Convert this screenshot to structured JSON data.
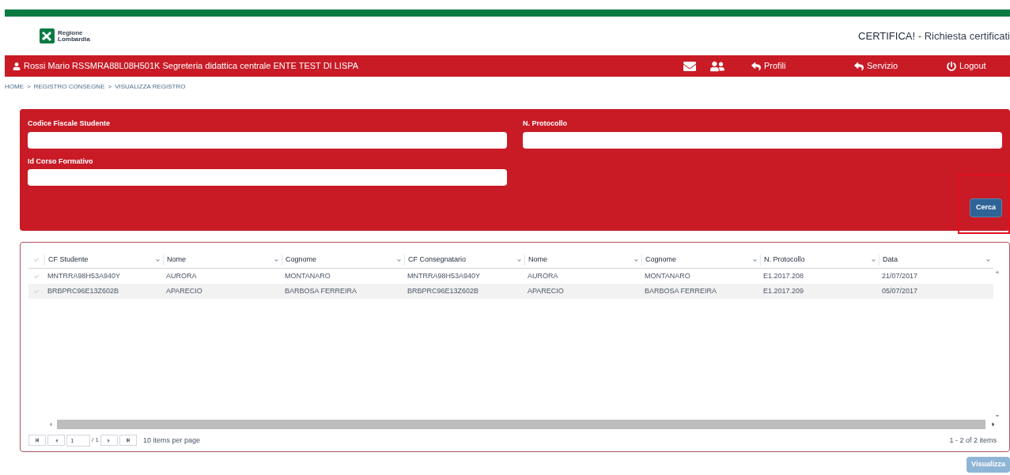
{
  "header": {
    "logo_text": [
      "Regione",
      "Lombardia"
    ],
    "app_title": "CERTIFICA!",
    "app_subtitle": " - Richiesta certificati"
  },
  "user_bar": {
    "user": "Rossi Mario RSSMRA88L08H501K Segreteria didattica centrale ENTE TEST DI LISPA",
    "links": [
      {
        "kind": "back",
        "label": "Profili"
      },
      {
        "kind": "back",
        "label": "Servizio"
      },
      {
        "kind": "power",
        "label": "Logout"
      }
    ]
  },
  "breadcrumb": {
    "items": [
      "HOME",
      "REGISTRO CONSEGNE",
      "VISUALIZZA REGISTRO"
    ],
    "separator": ">"
  },
  "search_form": {
    "fields": [
      {
        "label": "Codice Fiscale Studente"
      },
      {
        "label": "N. Protocollo"
      },
      {
        "label": "Id Corso Formativo"
      }
    ],
    "button": "Cerca"
  },
  "table": {
    "columns": [
      "CF Studente",
      "Nome",
      "Cognome",
      "CF Consegnatario",
      "Nome",
      "Cognome",
      "N. Protocollo",
      "Data"
    ],
    "rows": [
      [
        "MNTRRA98H53A940Y",
        "AURORA",
        "MONTANARO",
        "MNTRRA98H53A940Y",
        "AURORA",
        "MONTANARO",
        "E1.2017.208",
        "21/07/2017"
      ],
      [
        "BRBPRC96E13Z602B",
        "APARECIO",
        "BARBOSA FERREIRA",
        "BRBPRC96E13Z602B",
        "APARECIO",
        "BARBOSA FERREIRA",
        "E1.2017.209",
        "05/07/2017"
      ]
    ],
    "pager": {
      "page": "1",
      "of_pages": "/ 1",
      "per_page": "10 items per page",
      "summary": "1 - 2 of 2 items"
    }
  },
  "footer_button": {
    "label": "Visualizza",
    "disabled": true
  }
}
